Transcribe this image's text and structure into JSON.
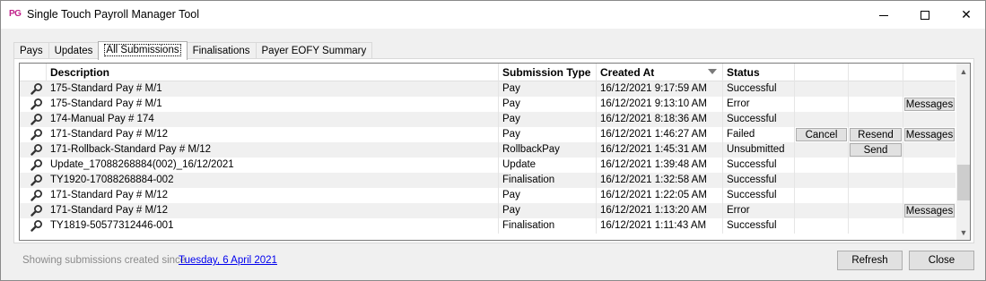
{
  "window": {
    "app_icon": "PG",
    "title": "Single Touch Payroll Manager Tool",
    "minimize_icon": "minimize-icon",
    "maximize_icon": "maximize-icon",
    "close_icon": "close-icon",
    "close_glyph": "✕"
  },
  "tabs": [
    {
      "label": "Pays"
    },
    {
      "label": "Updates"
    },
    {
      "label": "All Submissions",
      "active": true
    },
    {
      "label": "Finalisations"
    },
    {
      "label": "Payer EOFY Summary"
    }
  ],
  "grid": {
    "columns": {
      "description": "Description",
      "submission_type": "Submission Type",
      "created_at": "Created At",
      "status": "Status"
    },
    "sort": {
      "column": "created_at",
      "direction": "descending"
    },
    "row_icon": "magnifier-icon",
    "rows": [
      {
        "description": "175-Standard Pay # M/1",
        "type": "Pay",
        "created": "16/12/2021 9:17:59 AM",
        "status": "Successful",
        "b1": "",
        "b2": "",
        "b3": ""
      },
      {
        "description": "175-Standard Pay # M/1",
        "type": "Pay",
        "created": "16/12/2021 9:13:10 AM",
        "status": "Error",
        "b1": "",
        "b2": "",
        "b3": "Messages"
      },
      {
        "description": "174-Manual Pay # 174",
        "type": "Pay",
        "created": "16/12/2021 8:18:36 AM",
        "status": "Successful",
        "b1": "",
        "b2": "",
        "b3": ""
      },
      {
        "description": "171-Standard Pay # M/12",
        "type": "Pay",
        "created": "16/12/2021 1:46:27 AM",
        "status": "Failed",
        "b1": "Cancel",
        "b2": "Resend",
        "b3": "Messages"
      },
      {
        "description": "171-Rollback-Standard Pay # M/12",
        "type": "RollbackPay",
        "created": "16/12/2021 1:45:31 AM",
        "status": "Unsubmitted",
        "b1": "",
        "b2": "Send",
        "b3": ""
      },
      {
        "description": "Update_17088268884(002)_16/12/2021",
        "type": "Update",
        "created": "16/12/2021 1:39:48 AM",
        "status": "Successful",
        "b1": "",
        "b2": "",
        "b3": ""
      },
      {
        "description": "TY1920-17088268884-002",
        "type": "Finalisation",
        "created": "16/12/2021 1:32:58 AM",
        "status": "Successful",
        "b1": "",
        "b2": "",
        "b3": ""
      },
      {
        "description": "171-Standard Pay # M/12",
        "type": "Pay",
        "created": "16/12/2021 1:22:05 AM",
        "status": "Successful",
        "b1": "",
        "b2": "",
        "b3": ""
      },
      {
        "description": "171-Standard Pay # M/12",
        "type": "Pay",
        "created": "16/12/2021 1:13:20 AM",
        "status": "Error",
        "b1": "",
        "b2": "",
        "b3": "Messages"
      },
      {
        "description": "TY1819-50577312446-001",
        "type": "Finalisation",
        "created": "16/12/2021 1:11:43 AM",
        "status": "Successful",
        "b1": "",
        "b2": "",
        "b3": ""
      }
    ]
  },
  "scrollbar": {
    "up_glyph": "▲",
    "down_glyph": "▼"
  },
  "footer": {
    "info_text": "Showing submissions created since",
    "since_date": "Tuesday, 6 April 2021",
    "refresh_label": "Refresh",
    "close_label": "Close"
  }
}
